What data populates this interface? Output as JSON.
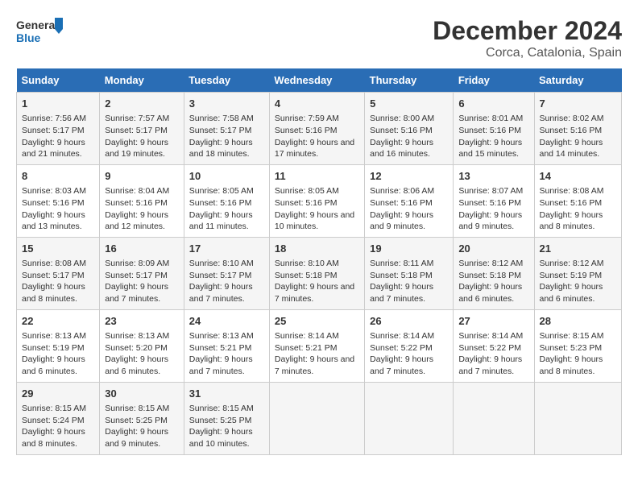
{
  "logo": {
    "line1": "General",
    "line2": "Blue"
  },
  "title": "December 2024",
  "subtitle": "Corca, Catalonia, Spain",
  "headers": [
    "Sunday",
    "Monday",
    "Tuesday",
    "Wednesday",
    "Thursday",
    "Friday",
    "Saturday"
  ],
  "weeks": [
    [
      {
        "day": "1",
        "sunrise": "7:56 AM",
        "sunset": "5:17 PM",
        "daylight": "9 hours and 21 minutes."
      },
      {
        "day": "2",
        "sunrise": "7:57 AM",
        "sunset": "5:17 PM",
        "daylight": "9 hours and 19 minutes."
      },
      {
        "day": "3",
        "sunrise": "7:58 AM",
        "sunset": "5:17 PM",
        "daylight": "9 hours and 18 minutes."
      },
      {
        "day": "4",
        "sunrise": "7:59 AM",
        "sunset": "5:16 PM",
        "daylight": "9 hours and 17 minutes."
      },
      {
        "day": "5",
        "sunrise": "8:00 AM",
        "sunset": "5:16 PM",
        "daylight": "9 hours and 16 minutes."
      },
      {
        "day": "6",
        "sunrise": "8:01 AM",
        "sunset": "5:16 PM",
        "daylight": "9 hours and 15 minutes."
      },
      {
        "day": "7",
        "sunrise": "8:02 AM",
        "sunset": "5:16 PM",
        "daylight": "9 hours and 14 minutes."
      }
    ],
    [
      {
        "day": "8",
        "sunrise": "8:03 AM",
        "sunset": "5:16 PM",
        "daylight": "9 hours and 13 minutes."
      },
      {
        "day": "9",
        "sunrise": "8:04 AM",
        "sunset": "5:16 PM",
        "daylight": "9 hours and 12 minutes."
      },
      {
        "day": "10",
        "sunrise": "8:05 AM",
        "sunset": "5:16 PM",
        "daylight": "9 hours and 11 minutes."
      },
      {
        "day": "11",
        "sunrise": "8:05 AM",
        "sunset": "5:16 PM",
        "daylight": "9 hours and 10 minutes."
      },
      {
        "day": "12",
        "sunrise": "8:06 AM",
        "sunset": "5:16 PM",
        "daylight": "9 hours and 9 minutes."
      },
      {
        "day": "13",
        "sunrise": "8:07 AM",
        "sunset": "5:16 PM",
        "daylight": "9 hours and 9 minutes."
      },
      {
        "day": "14",
        "sunrise": "8:08 AM",
        "sunset": "5:16 PM",
        "daylight": "9 hours and 8 minutes."
      }
    ],
    [
      {
        "day": "15",
        "sunrise": "8:08 AM",
        "sunset": "5:17 PM",
        "daylight": "9 hours and 8 minutes."
      },
      {
        "day": "16",
        "sunrise": "8:09 AM",
        "sunset": "5:17 PM",
        "daylight": "9 hours and 7 minutes."
      },
      {
        "day": "17",
        "sunrise": "8:10 AM",
        "sunset": "5:17 PM",
        "daylight": "9 hours and 7 minutes."
      },
      {
        "day": "18",
        "sunrise": "8:10 AM",
        "sunset": "5:18 PM",
        "daylight": "9 hours and 7 minutes."
      },
      {
        "day": "19",
        "sunrise": "8:11 AM",
        "sunset": "5:18 PM",
        "daylight": "9 hours and 7 minutes."
      },
      {
        "day": "20",
        "sunrise": "8:12 AM",
        "sunset": "5:18 PM",
        "daylight": "9 hours and 6 minutes."
      },
      {
        "day": "21",
        "sunrise": "8:12 AM",
        "sunset": "5:19 PM",
        "daylight": "9 hours and 6 minutes."
      }
    ],
    [
      {
        "day": "22",
        "sunrise": "8:13 AM",
        "sunset": "5:19 PM",
        "daylight": "9 hours and 6 minutes."
      },
      {
        "day": "23",
        "sunrise": "8:13 AM",
        "sunset": "5:20 PM",
        "daylight": "9 hours and 6 minutes."
      },
      {
        "day": "24",
        "sunrise": "8:13 AM",
        "sunset": "5:21 PM",
        "daylight": "9 hours and 7 minutes."
      },
      {
        "day": "25",
        "sunrise": "8:14 AM",
        "sunset": "5:21 PM",
        "daylight": "9 hours and 7 minutes."
      },
      {
        "day": "26",
        "sunrise": "8:14 AM",
        "sunset": "5:22 PM",
        "daylight": "9 hours and 7 minutes."
      },
      {
        "day": "27",
        "sunrise": "8:14 AM",
        "sunset": "5:22 PM",
        "daylight": "9 hours and 7 minutes."
      },
      {
        "day": "28",
        "sunrise": "8:15 AM",
        "sunset": "5:23 PM",
        "daylight": "9 hours and 8 minutes."
      }
    ],
    [
      {
        "day": "29",
        "sunrise": "8:15 AM",
        "sunset": "5:24 PM",
        "daylight": "9 hours and 8 minutes."
      },
      {
        "day": "30",
        "sunrise": "8:15 AM",
        "sunset": "5:25 PM",
        "daylight": "9 hours and 9 minutes."
      },
      {
        "day": "31",
        "sunrise": "8:15 AM",
        "sunset": "5:25 PM",
        "daylight": "9 hours and 10 minutes."
      },
      null,
      null,
      null,
      null
    ]
  ]
}
